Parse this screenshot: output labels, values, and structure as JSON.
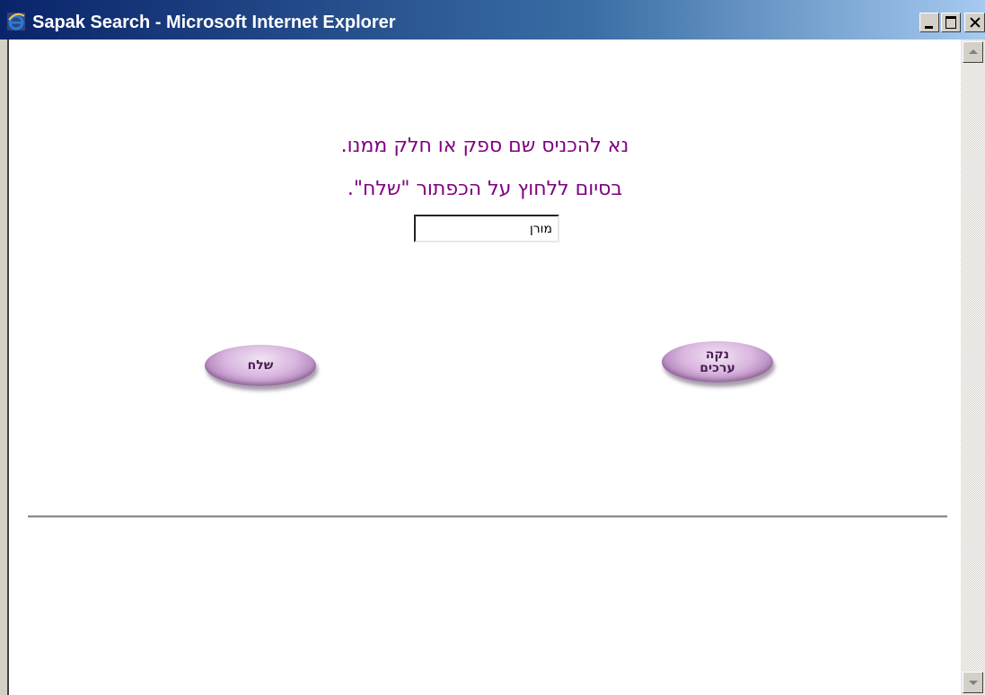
{
  "window": {
    "title": "Sapak Search - Microsoft Internet Explorer",
    "icon": "ie-icon"
  },
  "controls": {
    "minimize": "minimize-icon",
    "maximize": "maximize-icon",
    "close": "close-icon"
  },
  "page": {
    "instruction_line1": "נא להכניס שם ספק או חלק ממנו.",
    "instruction_line2": "בסיום ללחוץ על הכפתור \"שלח\".",
    "search": {
      "value": "מורן",
      "placeholder": ""
    },
    "send_button": "שלח",
    "clear_button": [
      "נקה",
      "ערכים"
    ]
  },
  "colors": {
    "instruction_text": "#800080",
    "button_fill": "#d9b6df",
    "title_bar": "#0a246a"
  }
}
